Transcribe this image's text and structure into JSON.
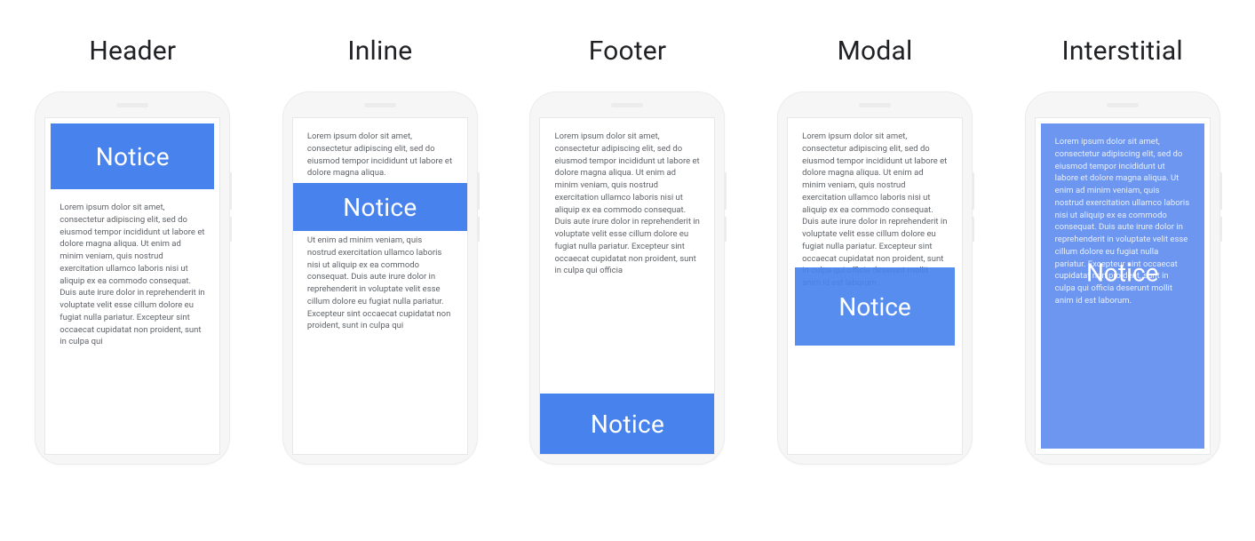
{
  "variants": [
    {
      "title": "Header",
      "notice_label": "Notice"
    },
    {
      "title": "Inline",
      "notice_label": "Notice"
    },
    {
      "title": "Footer",
      "notice_label": "Notice"
    },
    {
      "title": "Modal",
      "notice_label": "Notice"
    },
    {
      "title": "Interstitial",
      "notice_label": "Notice"
    }
  ],
  "lorem": {
    "p1": "Lorem ipsum dolor sit amet, consectetur adipiscing elit, sed do eiusmod tempor incididunt ut labore et dolore magna aliqua. Ut enim ad minim veniam, quis nostrud exercitation ullamco laboris nisi ut aliquip ex ea commodo consequat. Duis aute irure dolor in reprehenderit in voluptate velit esse cillum dolore eu fugiat nulla pariatur. Excepteur sint occaecat cupidatat non proident, sunt in culpa qui",
    "short_top": "Lorem ipsum dolor sit amet, consectetur adipiscing elit, sed do eiusmod tempor incididunt ut labore et dolore magna aliqua.",
    "p2": "Ut enim ad minim veniam, quis nostrud exercitation ullamco laboris nisi ut aliquip ex ea commodo consequat. Duis aute irure dolor in reprehenderit in voluptate velit esse cillum dolore eu fugiat nulla pariatur. Excepteur sint occaecat cupidatat non proident, sunt in culpa qui",
    "footer_body": "Lorem ipsum dolor sit amet, consectetur adipiscing elit, sed do eiusmod tempor incididunt ut labore et dolore magna aliqua. Ut enim ad minim veniam, quis nostrud exercitation ullamco laboris nisi ut aliquip ex ea commodo consequat. Duis aute irure dolor in reprehenderit in voluptate velit esse cillum dolore eu fugiat nulla pariatur. Excepteur sint occaecat cupidatat non proident, sunt in culpa qui officia",
    "modal_body": "Lorem ipsum dolor sit amet, consectetur adipiscing elit, sed do eiusmod tempor incididunt ut labore et dolore magna aliqua. Ut enim ad minim veniam, quis nostrud exercitation ullamco laboris nisi ut aliquip ex ea commodo consequat. Duis aute irure dolor in reprehenderit in voluptate velit esse cillum dolore eu fugiat nulla pariatur. Excepteur sint occaecat cupidatat non proident, sunt in culpa qui officia deserunt mollit anim id est laborum.",
    "interstitial_body": "Lorem ipsum dolor sit amet, consectetur adipiscing elit, sed do eiusmod tempor incididunt ut labore et dolore magna aliqua. Ut enim ad minim veniam, quis nostrud exercitation ullamco laboris nisi ut aliquip ex ea commodo consequat. Duis aute irure dolor in reprehenderit in voluptate velit esse cillum dolore eu fugiat nulla pariatur. Excepteur sint occaecat cupidatat non proident, sunt in culpa qui officia deserunt mollit anim id est laborum."
  },
  "colors": {
    "notice_blue": "#4883ED",
    "text_gray": "#5f6368"
  }
}
